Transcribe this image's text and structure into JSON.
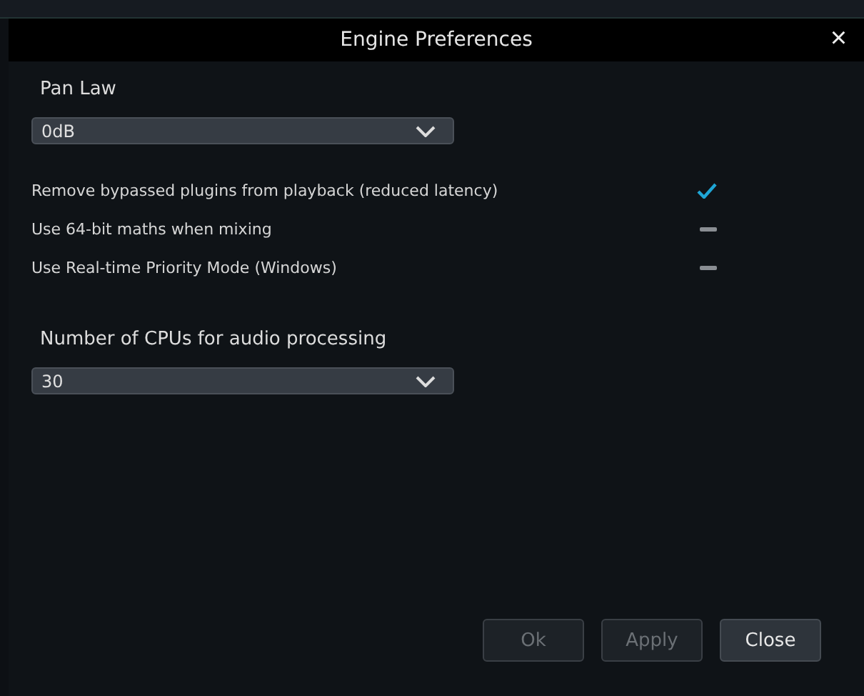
{
  "window": {
    "title": "Engine Preferences",
    "close": "×"
  },
  "pan_law": {
    "label": "Pan Law",
    "value": "0dB"
  },
  "options": [
    {
      "label": "Remove bypassed plugins from playback (reduced latency)",
      "checked": true
    },
    {
      "label": "Use 64-bit maths when mixing",
      "checked": false
    },
    {
      "label": "Use Real-time Priority Mode (Windows)",
      "checked": false
    }
  ],
  "cpus": {
    "label": "Number of CPUs for audio processing",
    "value": "30"
  },
  "buttons": [
    {
      "label": "Ok",
      "disabled": true
    },
    {
      "label": "Apply",
      "disabled": true
    },
    {
      "label": "Close",
      "disabled": false
    }
  ]
}
